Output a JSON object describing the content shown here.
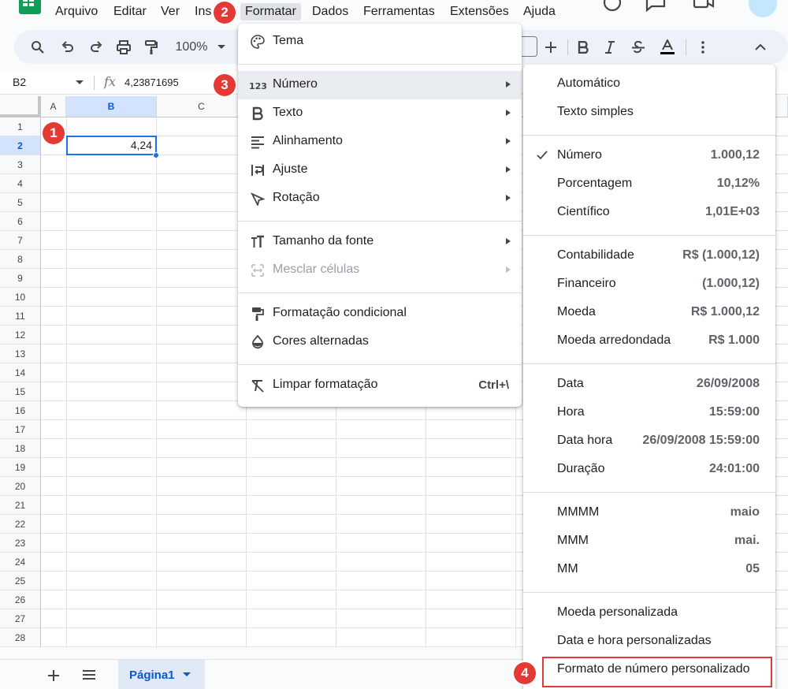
{
  "menubar": {
    "items": [
      "Arquivo",
      "Editar",
      "Ver",
      "Inse",
      "Formatar",
      "Dados",
      "Ferramentas",
      "Extensões",
      "Ajuda"
    ]
  },
  "toolbar": {
    "zoom": "100%"
  },
  "formula_bar": {
    "cell_ref": "B2",
    "fx": "fx",
    "value": "4,23871695"
  },
  "grid": {
    "columns": [
      "A",
      "B",
      "C"
    ],
    "rows": [
      "1",
      "2",
      "3",
      "4",
      "5",
      "6",
      "7",
      "8",
      "9",
      "10",
      "11",
      "12",
      "13",
      "14",
      "15",
      "16",
      "17",
      "18",
      "19",
      "20",
      "21",
      "22",
      "23",
      "24",
      "25",
      "26",
      "27",
      "28"
    ],
    "active_cell_value": "4,24"
  },
  "bottom": {
    "sheet_tab": "Página1"
  },
  "format_menu": {
    "items": [
      {
        "label": "Tema",
        "icon": "palette-icon"
      },
      {
        "label": "Número",
        "icon": "number-123-icon",
        "submenu": true
      },
      {
        "label": "Texto",
        "icon": "bold-icon",
        "submenu": true
      },
      {
        "label": "Alinhamento",
        "icon": "align-icon",
        "submenu": true
      },
      {
        "label": "Ajuste",
        "icon": "wrap-icon",
        "submenu": true
      },
      {
        "label": "Rotação",
        "icon": "rotate-icon",
        "submenu": true
      },
      {
        "label": "Tamanho da fonte",
        "icon": "font-size-icon",
        "submenu": true
      },
      {
        "label": "Mesclar células",
        "icon": "merge-icon",
        "submenu": true,
        "disabled": true
      },
      {
        "label": "Formatação condicional",
        "icon": "paint-roller-icon"
      },
      {
        "label": "Cores alternadas",
        "icon": "drop-icon"
      },
      {
        "label": "Limpar formatação",
        "icon": "clear-format-icon",
        "shortcut": "Ctrl+\\"
      }
    ]
  },
  "number_menu": {
    "items": [
      {
        "label": "Automático",
        "example": ""
      },
      {
        "label": "Texto simples",
        "example": ""
      },
      {
        "label": "Número",
        "example": "1.000,12",
        "checked": true
      },
      {
        "label": "Porcentagem",
        "example": "10,12%"
      },
      {
        "label": "Científico",
        "example": "1,01E+03"
      },
      {
        "label": "Contabilidade",
        "example": "R$ (1.000,12)"
      },
      {
        "label": "Financeiro",
        "example": "(1.000,12)"
      },
      {
        "label": "Moeda",
        "example": "R$ 1.000,12"
      },
      {
        "label": "Moeda arredondada",
        "example": "R$ 1.000"
      },
      {
        "label": "Data",
        "example": "26/09/2008"
      },
      {
        "label": "Hora",
        "example": "15:59:00"
      },
      {
        "label": "Data hora",
        "example": "26/09/2008 15:59:00"
      },
      {
        "label": "Duração",
        "example": "24:01:00"
      },
      {
        "label": "MMMM",
        "example": "maio"
      },
      {
        "label": "MMM",
        "example": "mai."
      },
      {
        "label": "MM",
        "example": "05"
      },
      {
        "label": "Moeda personalizada",
        "example": ""
      },
      {
        "label": "Data e hora personalizadas",
        "example": ""
      },
      {
        "label": "Formato de número personalizado",
        "example": ""
      }
    ]
  },
  "badges": [
    "1",
    "2",
    "3",
    "4"
  ],
  "colors": {
    "accent": "#1a73e8",
    "badge": "#e53935",
    "sheets_green": "#0f9d58"
  }
}
